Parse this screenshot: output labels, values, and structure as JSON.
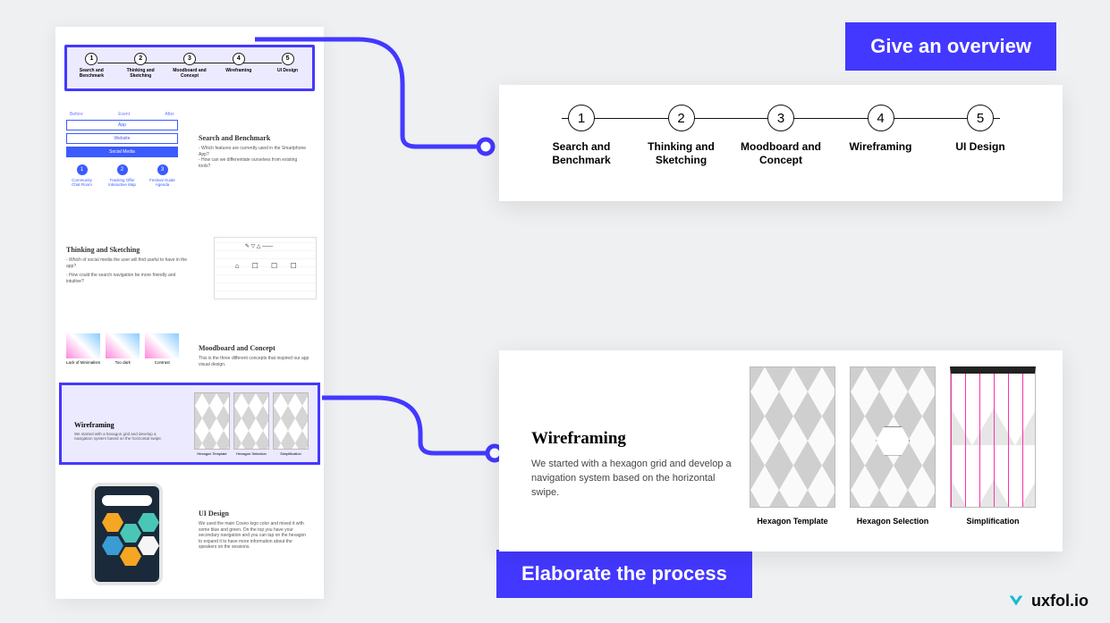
{
  "callouts": {
    "overview": "Give an overview",
    "elaborate": "Elaborate the process"
  },
  "steps": [
    {
      "num": "1",
      "label": "Search and Benchmark"
    },
    {
      "num": "2",
      "label": "Thinking and Sketching"
    },
    {
      "num": "3",
      "label": "Moodboard and Concept"
    },
    {
      "num": "4",
      "label": "Wireframing"
    },
    {
      "num": "5",
      "label": "UI Design"
    }
  ],
  "wireframe": {
    "title": "Wireframing",
    "body": "We started with a hexagon grid and develop a navigation system based on the horizontal swipe.",
    "captions": [
      "Hexagon Template",
      "Hexagon Selection",
      "Simplification"
    ]
  },
  "casestudy": {
    "tabs": {
      "col1": "Before",
      "col2": "Event",
      "col3": "After",
      "btn1": "App",
      "btn2": "Website",
      "btn3": "Social Media"
    },
    "icons": [
      {
        "n": "1",
        "a": "Community",
        "b": "Chat Room"
      },
      {
        "n": "2",
        "a": "Tracking Offer",
        "b": "Interactive Map"
      },
      {
        "n": "3",
        "a": "Festival Guide",
        "b": "Agenda"
      }
    ],
    "s1": {
      "h": "Search and Benchmark",
      "p1": "- Which features are currently used in the Smartphone App?",
      "p2": "- How can we differentiate ourselves from existing tools?"
    },
    "s2": {
      "h": "Thinking and Sketching",
      "p1": "- Which of social media the user will find useful to have in the app?",
      "p2": "- How could the search navigation be more friendly and intuitive?"
    },
    "s3": {
      "h": "Moodboard and Concept",
      "p": "This is the three different concepts that inspired our app visual design."
    },
    "thumbcaps": [
      "Lack of Minimalism",
      "Too dark",
      "Contrast"
    ],
    "s4": {
      "h": "Wireframing",
      "p": "We started with a hexagon grid and develop a navigation system based on the horizontal swipe."
    },
    "wirecaps": [
      "Hexagon Template",
      "Hexagon Selection",
      "Simplification"
    ],
    "s5": {
      "h": "UI Design",
      "p": "We used the main Coveo logo color and mixed it with some blue and green. On the top you have your secondary navigation and you can tap on the hexagon to expand it to have more information about the speakers on the sessions."
    }
  },
  "brand": "uxfol.io"
}
